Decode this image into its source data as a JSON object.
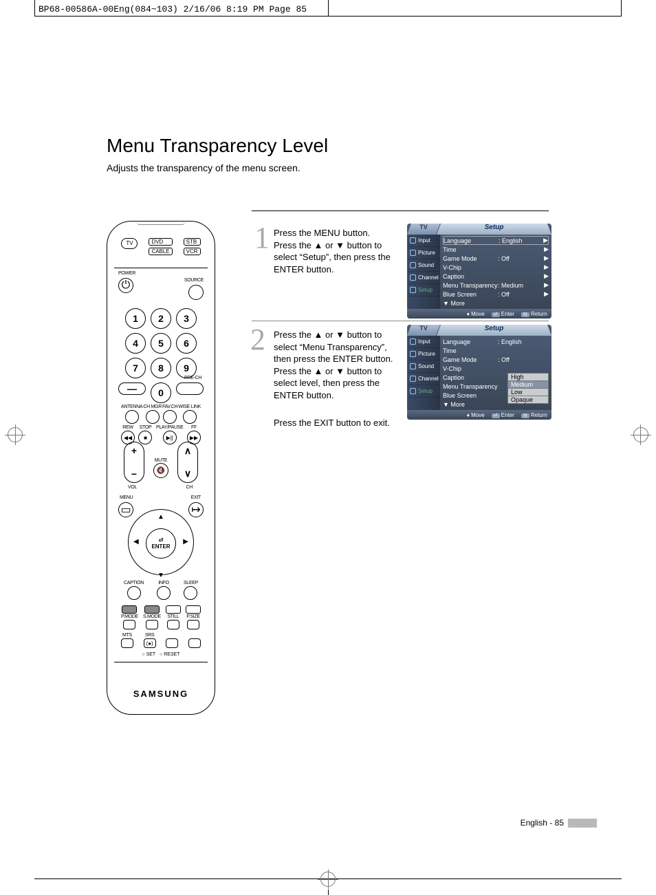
{
  "slug": "BP68-00586A-00Eng(084~103)  2/16/06  8:19 PM  Page 85",
  "title": "Menu Transparency Level",
  "subtitle": "Adjusts the transparency of the menu screen.",
  "remote": {
    "modeButtons": [
      "TV",
      "DVD",
      "STB",
      "CABLE",
      "VCR"
    ],
    "power": "POWER",
    "source": "SOURCE",
    "digits": [
      "1",
      "2",
      "3",
      "4",
      "5",
      "6",
      "7",
      "8",
      "9",
      "0"
    ],
    "dash": "—",
    "prech": "PRE-CH",
    "row_small": [
      "ANTENNA",
      "CH MGR",
      "FAV.CH",
      "WISE LINK"
    ],
    "transport": [
      "REW",
      "STOP",
      "PLAY/PAUSE",
      "FF"
    ],
    "transport_sym": [
      "◀◀",
      "■",
      "▶||",
      "▶▶"
    ],
    "vol": "VOL",
    "ch": "CH",
    "mute": "MUTE",
    "menu": "MENU",
    "exit": "EXIT",
    "enter": "ENTER",
    "row_bot1": [
      "CAPTION",
      "INFO",
      "SLEEP"
    ],
    "row_bot2": [
      "P.MODE",
      "S.MODE",
      "STILL",
      "P.SIZE"
    ],
    "row_bot3": [
      "MTS",
      "SRS"
    ],
    "set": "SET",
    "reset": "RESET",
    "brand": "SAMSUNG"
  },
  "steps": [
    {
      "num": "1",
      "text": "Press the MENU button.\nPress the ▲ or ▼ button to select “Setup”, then press the ENTER button."
    },
    {
      "num": "2",
      "text": "Press the ▲ or ▼ button to select “Menu Transparency”, then press the ENTER button.\nPress the ▲ or ▼ button to select level, then press the ENTER button.",
      "after": "Press the EXIT button to exit."
    }
  ],
  "osd": {
    "tv": "TV",
    "setup": "Setup",
    "side": [
      "Input",
      "Picture",
      "Sound",
      "Channel",
      "Setup"
    ],
    "rows1": [
      {
        "label": "Language",
        "val": ": English",
        "arrow": true,
        "boxed": true
      },
      {
        "label": "Time",
        "val": "",
        "arrow": true
      },
      {
        "label": "Game Mode",
        "val": ": Off",
        "arrow": true
      },
      {
        "label": "V-Chip",
        "val": "",
        "arrow": true
      },
      {
        "label": "Caption",
        "val": "",
        "arrow": true
      },
      {
        "label": "Menu Transparency",
        "val": ": Medium",
        "arrow": true
      },
      {
        "label": "Blue Screen",
        "val": ": Off",
        "arrow": true
      },
      {
        "label": "▼ More",
        "val": "",
        "arrow": false
      }
    ],
    "rows2": [
      {
        "label": "Language",
        "val": ": English"
      },
      {
        "label": "Time",
        "val": ""
      },
      {
        "label": "Game Mode",
        "val": ": Off"
      },
      {
        "label": "V-Chip",
        "val": ""
      },
      {
        "label": "Caption",
        "val": ""
      },
      {
        "label": "Menu Transparency",
        "val": ""
      },
      {
        "label": "Blue Screen",
        "val": ""
      },
      {
        "label": "▼ More",
        "val": ""
      }
    ],
    "options": [
      "High",
      "Medium",
      "Low",
      "Opaque"
    ],
    "selectedOption": 1,
    "footer": {
      "move": "Move",
      "enter": "Enter",
      "return": "Return"
    }
  },
  "footer": {
    "lang": "English",
    "page": "85"
  }
}
